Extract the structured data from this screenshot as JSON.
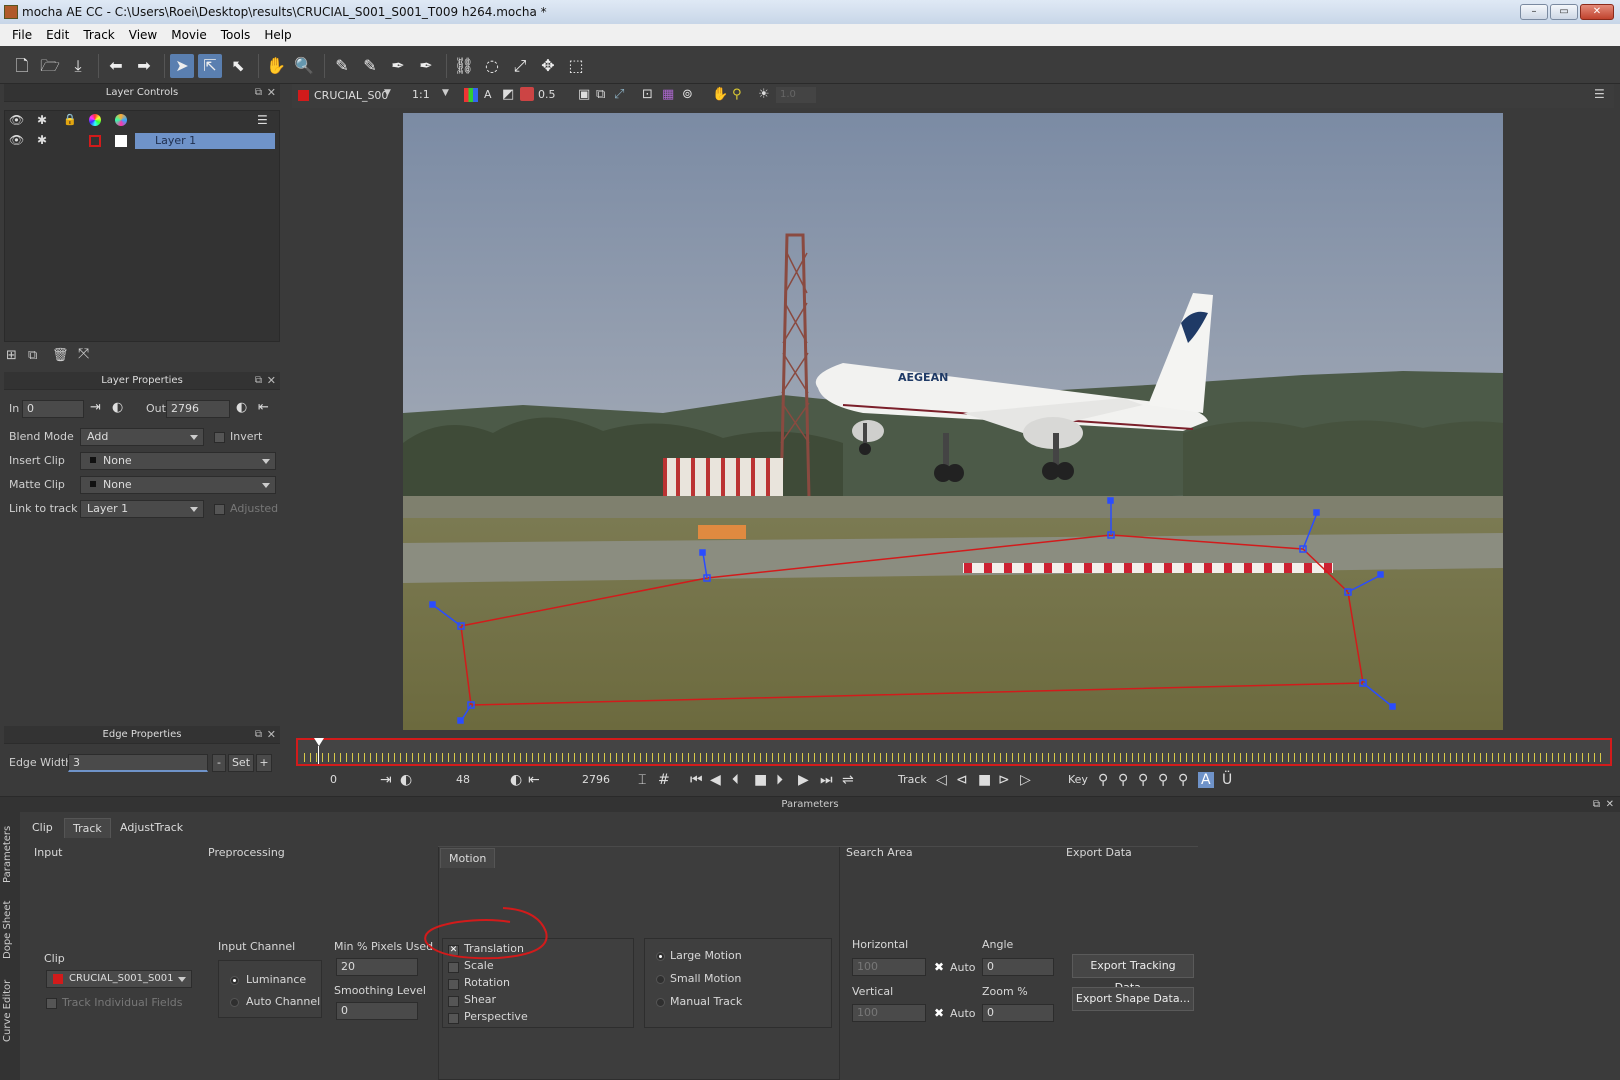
{
  "window": {
    "title": "mocha AE CC - C:\\Users\\Roei\\Desktop\\results\\CRUCIAL_S001_S001_T009 h264.mocha *"
  },
  "menu": [
    "File",
    "Edit",
    "Track",
    "View",
    "Movie",
    "Tools",
    "Help"
  ],
  "toolbar_icons": [
    "new-file-icon",
    "open-folder-icon",
    "save-icon",
    "undo-icon",
    "redo-icon",
    "select-icon",
    "select-points-icon",
    "add-point-icon",
    "hand-icon",
    "zoom-icon",
    "xspline-icon",
    "xspline-add-icon",
    "bezier-icon",
    "bezier-add-icon",
    "link-icon",
    "magnetic-icon",
    "transform-icon",
    "move-icon",
    "surface-icon"
  ],
  "layer_controls": {
    "title": "Layer Controls",
    "layers": [
      {
        "name": "Layer 1",
        "color": "#d21b1b"
      }
    ]
  },
  "layer_properties": {
    "title": "Layer Properties",
    "in_label": "In",
    "in_value": "0",
    "out_label": "Out",
    "out_value": "2796",
    "blend_mode_label": "Blend Mode",
    "blend_mode_value": "Add",
    "invert_label": "Invert",
    "insert_clip_label": "Insert Clip",
    "insert_clip_value": "None",
    "matte_clip_label": "Matte Clip",
    "matte_clip_value": "None",
    "link_to_track_label": "Link to track",
    "link_to_track_value": "Layer 1",
    "adjusted_label": "Adjusted"
  },
  "edge_properties": {
    "title": "Edge Properties",
    "edge_width_label": "Edge Width",
    "edge_width_value": "3",
    "minus_label": "-",
    "set_label": "Set",
    "plus_label": "+"
  },
  "viewer_bar": {
    "clip": "CRUCIAL_S00",
    "zoom": "1:1",
    "opacity": "0.5",
    "a_label": "A",
    "exposure": "1.0"
  },
  "transport": {
    "start": "0",
    "current": "48",
    "end": "2796",
    "track_label": "Track",
    "key_label": "Key"
  },
  "params": {
    "title": "Parameters",
    "side_tabs": [
      "Parameters",
      "Dope Sheet",
      "Curve Editor"
    ],
    "tabs": [
      "Clip",
      "Track",
      "AdjustTrack"
    ],
    "active_tab": "Track",
    "input_title": "Input",
    "clip_label": "Clip",
    "clip_value": "CRUCIAL_S001_S001",
    "track_individual_fields": "Track Individual Fields",
    "preprocessing_title": "Preprocessing",
    "input_channel_label": "Input Channel",
    "luminance": "Luminance",
    "auto_channel": "Auto Channel",
    "min_pixels_label": "Min % Pixels Used",
    "min_pixels_value": "20",
    "smoothing_label": "Smoothing Level",
    "smoothing_value": "0",
    "motion_title": "Motion",
    "motion_types": [
      {
        "label": "Translation",
        "checked": true
      },
      {
        "label": "Scale",
        "checked": false
      },
      {
        "label": "Rotation",
        "checked": false
      },
      {
        "label": "Shear",
        "checked": false
      },
      {
        "label": "Perspective",
        "checked": false
      }
    ],
    "motion_modes": [
      "Large Motion",
      "Small Motion",
      "Manual Track"
    ],
    "search_area_title": "Search Area",
    "horizontal_label": "Horizontal",
    "horizontal_value": "100",
    "vertical_label": "Vertical",
    "vertical_value": "100",
    "auto_label": "Auto",
    "angle_label": "Angle",
    "angle_value": "0",
    "zoom_label": "Zoom %",
    "zoom_value": "0",
    "export_title": "Export Data",
    "export_tracking": "Export Tracking Data...",
    "export_shape": "Export Shape Data..."
  },
  "annotation": {
    "color": "#d21b1b"
  },
  "scene": {
    "airline_text": "AEGEAN"
  }
}
